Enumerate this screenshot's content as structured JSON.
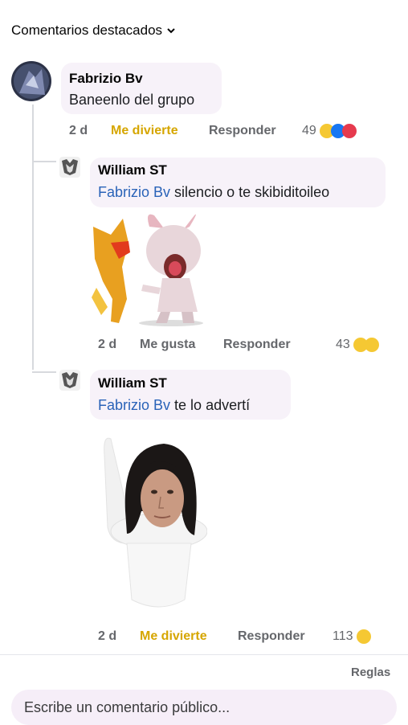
{
  "header": {
    "title": "Comentarios destacados"
  },
  "comments": [
    {
      "author": "Fabrizio Bv",
      "text": "Baneenlo del grupo",
      "time": "2 d",
      "reaction_label": "Me divierte",
      "reply_label": "Responder",
      "reaction_count": "49",
      "reaction_icons": [
        "laugh-emoji",
        "like-emoji",
        "love-emoji"
      ]
    },
    {
      "author": "William ST",
      "mention": "Fabrizio Bv",
      "text": "silencio o te skibiditoileo",
      "time": "2 d",
      "reaction_label": "Me gusta",
      "reply_label": "Responder",
      "reaction_count": "43",
      "reaction_icons": [
        "laugh-emoji",
        "wow-emoji"
      ]
    },
    {
      "author": "William ST",
      "mention": "Fabrizio Bv",
      "text": "te lo advertí",
      "time": "2 d",
      "reaction_label": "Me divierte",
      "reply_label": "Responder",
      "reaction_count": "113",
      "reaction_icons": [
        "laugh-emoji"
      ]
    }
  ],
  "footer": {
    "rules_label": "Reglas",
    "comment_placeholder": "Escribe un comentario público..."
  },
  "colors": {
    "mention": "#2a63b8",
    "reaction_active": "#d6a600",
    "meta_gray": "#65676b"
  }
}
